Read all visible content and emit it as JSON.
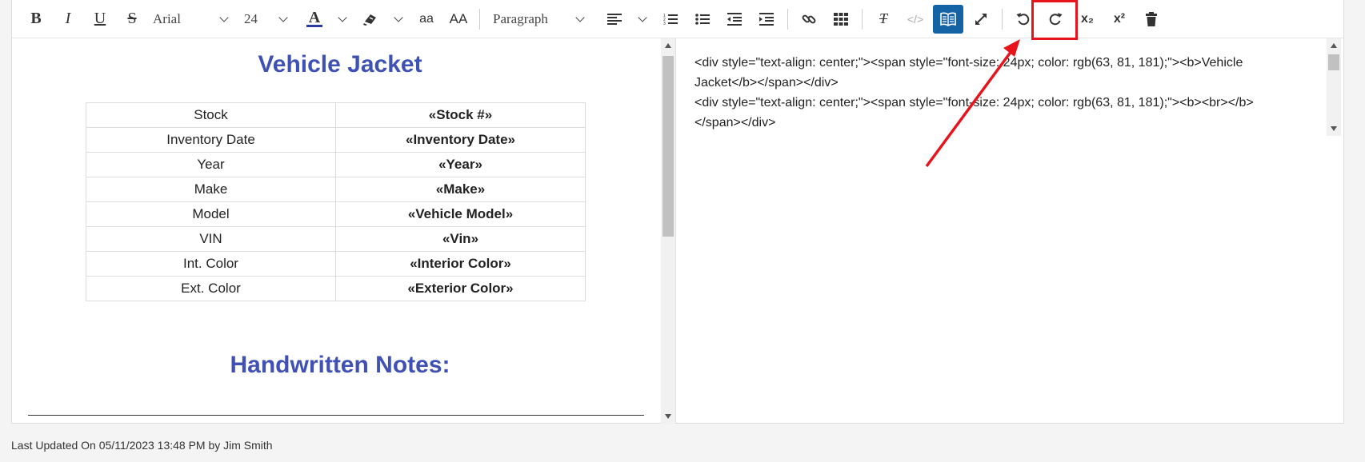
{
  "toolbar": {
    "bold_label": "B",
    "italic_label": "I",
    "underline_label": "U",
    "strike_label": "S",
    "font_family": "Arial",
    "font_size": "24",
    "font_color_label": "A",
    "case_lower_label": "aa",
    "case_upper_label": "AA",
    "block_format": "Paragraph",
    "clear_format_label": "T",
    "code_view_label": "</>",
    "subscript_label": "x₂",
    "superscript_label": "x²",
    "accent_color": "#1463a4"
  },
  "document": {
    "title": "Vehicle Jacket",
    "rows": [
      {
        "label": "Stock",
        "value": "«Stock #»"
      },
      {
        "label": "Inventory Date",
        "value": "«Inventory Date»"
      },
      {
        "label": "Year",
        "value": "«Year»"
      },
      {
        "label": "Make",
        "value": "«Make»"
      },
      {
        "label": "Model",
        "value": "«Vehicle Model»"
      },
      {
        "label": "VIN",
        "value": "«Vin»"
      },
      {
        "label": "Int. Color",
        "value": "«Interior Color»"
      },
      {
        "label": "Ext. Color",
        "value": "«Exterior Color»"
      }
    ],
    "notes_title": "Handwritten Notes:",
    "heading_color": "#3f51b5"
  },
  "source": {
    "line1a": "<div style=\"text-align: center;\"><span style=\"font-size: 24px; color: rgb(63, 81, 181);\"><b>Vehicle",
    "line1b": "Jacket</b></span></div>",
    "line2a": "<div style=\"text-align: center;\"><span style=\"font-size: 24px; color: rgb(63, 81, 181);\"><b><br></b>",
    "line2b": "</span></div>"
  },
  "footer": {
    "last_updated": "Last Updated On 05/11/2023 13:48 PM by Jim Smith"
  },
  "annotation_color": "#e8141c"
}
